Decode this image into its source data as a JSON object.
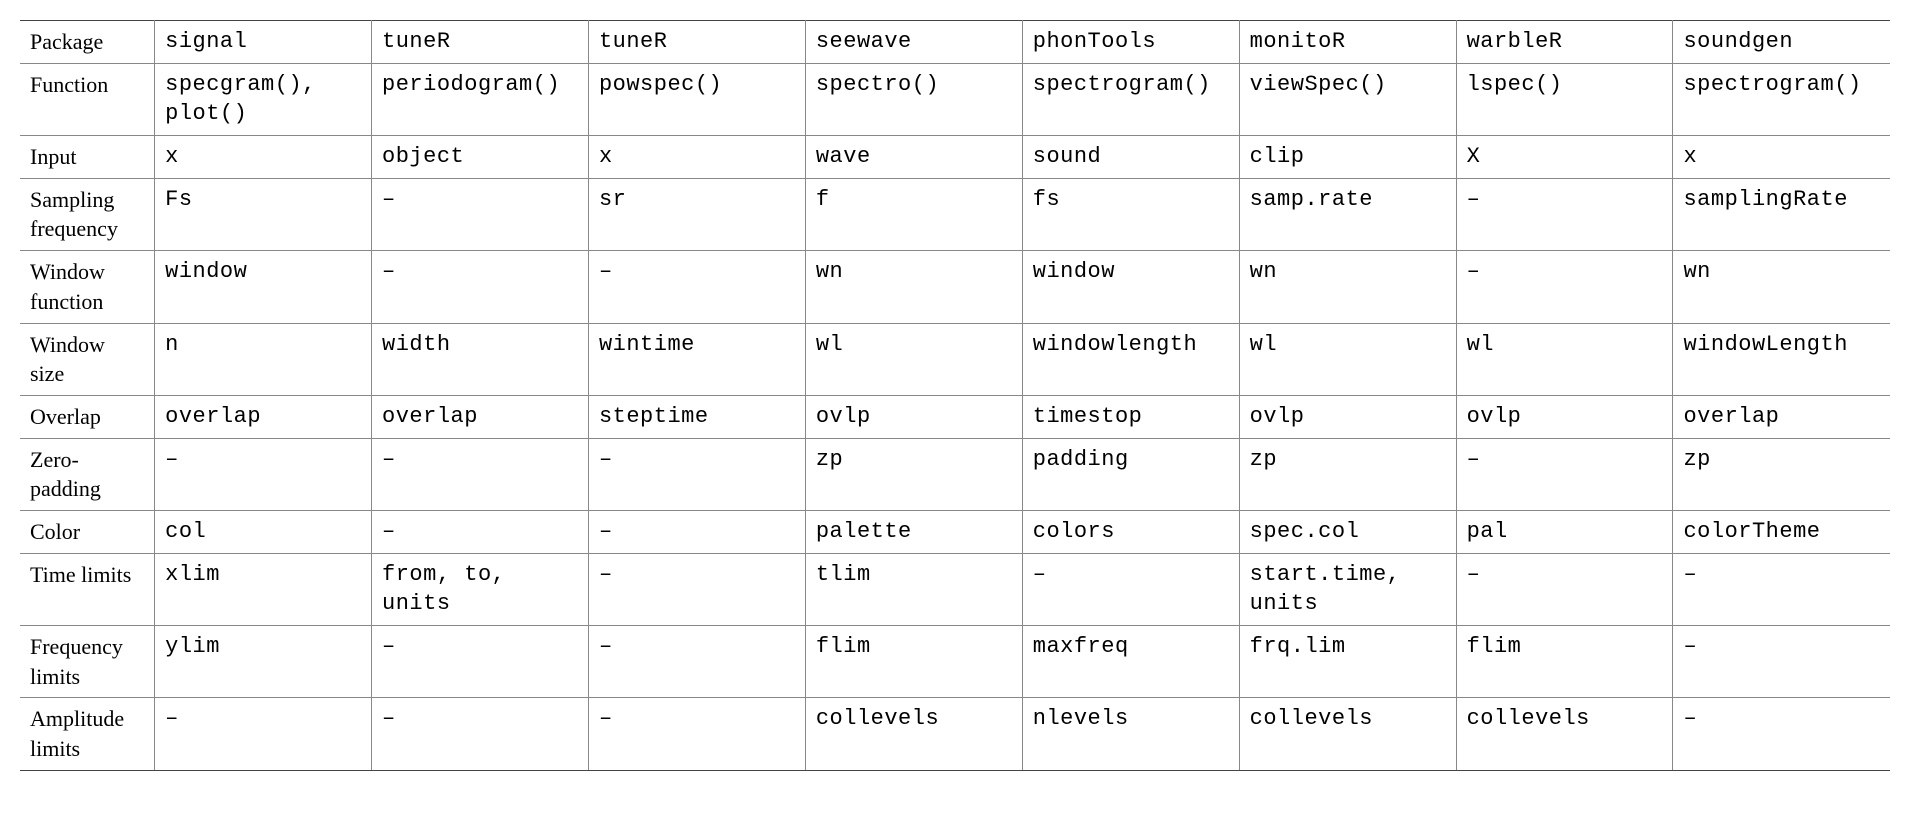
{
  "chart_data": {
    "type": "table",
    "row_labels": [
      "Package",
      "Function",
      "Input",
      "Sampling frequency",
      "Window function",
      "Window size",
      "Overlap",
      "Zero-padding",
      "Color",
      "Time limits",
      "Frequency limits",
      "Amplitude limits"
    ],
    "columns": [
      "signal",
      "tuneR",
      "tuneR",
      "seewave",
      "phonTools",
      "monitoR",
      "warbleR",
      "soundgen"
    ],
    "rows": [
      [
        "signal",
        "tuneR",
        "tuneR",
        "seewave",
        "phonTools",
        "monitoR",
        "warbleR",
        "soundgen"
      ],
      [
        "specgram(), plot()",
        "periodogram()",
        "powspec()",
        "spectro()",
        "spectrogram()",
        "viewSpec()",
        "lspec()",
        "spectrogram()"
      ],
      [
        "x",
        "object",
        "x",
        "wave",
        "sound",
        "clip",
        "X",
        "x"
      ],
      [
        "Fs",
        "–",
        "sr",
        "f",
        "fs",
        "samp.rate",
        "–",
        "samplingRate"
      ],
      [
        "window",
        "–",
        "–",
        "wn",
        "window",
        "wn",
        "–",
        "wn"
      ],
      [
        "n",
        "width",
        "wintime",
        "wl",
        "windowlength",
        "wl",
        "wl",
        "windowLength"
      ],
      [
        "overlap",
        "overlap",
        "steptime",
        "ovlp",
        "timestop",
        "ovlp",
        "ovlp",
        "overlap"
      ],
      [
        "–",
        "–",
        "–",
        "zp",
        "padding",
        "zp",
        "–",
        "zp"
      ],
      [
        "col",
        "–",
        "–",
        "palette",
        "colors",
        "spec.col",
        "pal",
        "colorTheme"
      ],
      [
        "xlim",
        "from, to, units",
        "–",
        "tlim",
        "–",
        "start.time, units",
        "–",
        "–"
      ],
      [
        "ylim",
        "–",
        "–",
        "flim",
        "maxfreq",
        "frq.lim",
        "flim",
        "–"
      ],
      [
        "–",
        "–",
        "–",
        "collevels",
        "nlevels",
        "collevels",
        "collevels",
        "–"
      ]
    ]
  }
}
